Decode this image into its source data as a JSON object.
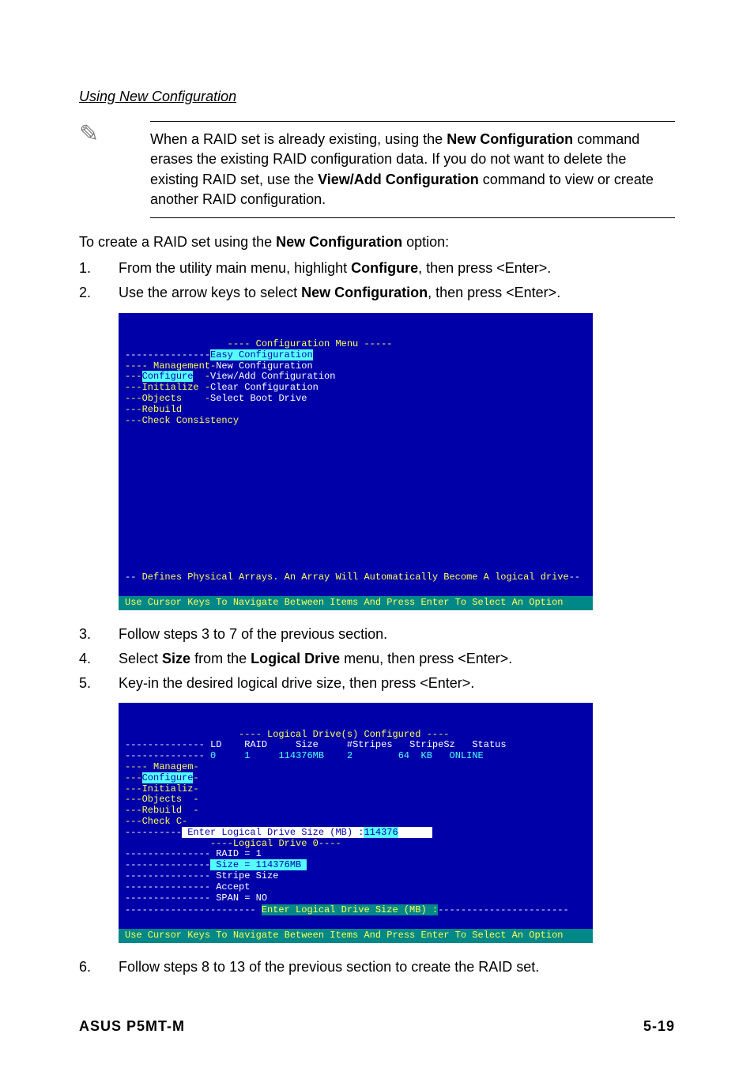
{
  "section_heading": "Using New Configuration",
  "note": {
    "line1": "When a RAID set is already existing, using the ",
    "bold1": "New Configuration",
    "line2": " command erases the existing RAID configuration data. If you do not want to delete the existing RAID set, use the ",
    "bold2": "View/Add Configuration",
    "line3": " command to view or create another RAID configuration."
  },
  "intro_pre": "To create a RAID set using the ",
  "intro_bold": "New Configuration",
  "intro_post": " option:",
  "steps_a": [
    {
      "n": "1.",
      "pre": "From the utility main menu, highlight ",
      "bold": "Configure",
      "post": ", then press <Enter>."
    },
    {
      "n": "2.",
      "pre": "Use the arrow keys to select ",
      "bold": "New Configuration",
      "post": ", then press <Enter>."
    }
  ],
  "bios1": {
    "title": "Configuration Menu",
    "items_left": [
      "Management",
      "Configure",
      "Initialize",
      "Objects",
      "Rebuild",
      "Check Consistency"
    ],
    "items_right": [
      "Easy Configuration",
      "New Configuration",
      "View/Add Configuration",
      "Clear Configuration",
      "Select Boot Drive"
    ],
    "help": "Defines Physical Arrays. An Array Will Automatically Become A logical drive",
    "hint": "Use Cursor Keys To Navigate Between Items And Press Enter To Select An Option"
  },
  "steps_b": [
    {
      "n": "3.",
      "text": "Follow steps 3 to 7 of the previous section."
    },
    {
      "n": "4.",
      "pre": "Select ",
      "bold1": "Size",
      "mid": " from the ",
      "bold2": "Logical Drive",
      "post": " menu, then press <Enter>."
    },
    {
      "n": "5.",
      "text": "Key-in the desired logical drive size, then press <Enter>."
    }
  ],
  "bios2": {
    "title": "Logical Drive(s) Configured",
    "headers": [
      "LD",
      "RAID",
      "Size",
      "#Stripes",
      "StripeSz",
      "Status"
    ],
    "row": {
      "ld": "0",
      "raid": "1",
      "size": "114376MB",
      "stripes": "2",
      "stripesz": "64  KB",
      "status": "ONLINE"
    },
    "left_menu": [
      "Managem",
      "Configure",
      "Initializ",
      "Objects",
      "Rebuild",
      "Check C"
    ],
    "enter_label": "Enter Logical Drive Size (MB) :",
    "enter_value": "114376",
    "ld0_title": "Logical Drive 0",
    "ld0_items": [
      "RAID = 1",
      "Size = 114376MB",
      "Stripe Size",
      "Accept",
      "SPAN = NO"
    ],
    "prompt": "Enter Logical Drive Size (MB) :",
    "hint": "Use Cursor Keys To Navigate Between Items And Press Enter To Select An Option"
  },
  "steps_c": [
    {
      "n": "6.",
      "text": "Follow steps 8 to 13 of the previous section to create the RAID set."
    }
  ],
  "footer_left": "ASUS P5MT-M",
  "footer_right": "5-19"
}
